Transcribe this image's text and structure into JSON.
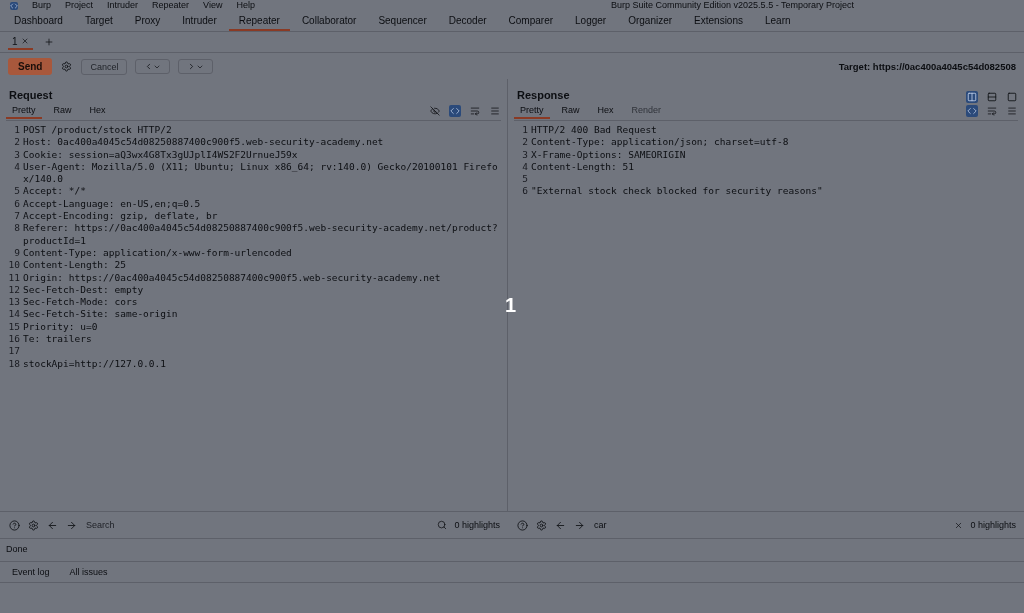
{
  "window": {
    "title": "Burp Suite Community Edition v2025.5.5 - Temporary Project",
    "menu": [
      "Burp",
      "Project",
      "Intruder",
      "Repeater",
      "View",
      "Help"
    ]
  },
  "main_tabs": [
    {
      "label": "Dashboard",
      "selected": false
    },
    {
      "label": "Target",
      "selected": false
    },
    {
      "label": "Proxy",
      "selected": false
    },
    {
      "label": "Intruder",
      "selected": false
    },
    {
      "label": "Repeater",
      "selected": true
    },
    {
      "label": "Collaborator",
      "selected": false
    },
    {
      "label": "Sequencer",
      "selected": false
    },
    {
      "label": "Decoder",
      "selected": false
    },
    {
      "label": "Comparer",
      "selected": false
    },
    {
      "label": "Logger",
      "selected": false
    },
    {
      "label": "Organizer",
      "selected": false
    },
    {
      "label": "Extensions",
      "selected": false
    },
    {
      "label": "Learn",
      "selected": false
    }
  ],
  "repeater_tabs": [
    {
      "label": "1",
      "selected": true
    }
  ],
  "toolbar": {
    "send": "Send",
    "cancel": "Cancel",
    "target": "Target: https://0ac400a4045c54d082508"
  },
  "view_modes": [
    {
      "selected": true
    },
    {
      "selected": false
    },
    {
      "selected": false
    }
  ],
  "request": {
    "title": "Request",
    "tabs": [
      {
        "label": "Pretty",
        "selected": true
      },
      {
        "label": "Raw",
        "selected": false
      },
      {
        "label": "Hex",
        "selected": false
      }
    ],
    "lines": [
      {
        "num": "1",
        "text": "POST /product/stock HTTP/2"
      },
      {
        "num": "2",
        "text": "Host: 0ac400a4045c54d08250887400c900f5.web-security-academy.net"
      },
      {
        "num": "3",
        "text": "Cookie: session=aQ3wx4G8Tx3gUJplI4WS2F2UrnueJ59x"
      },
      {
        "num": "4",
        "text": "User-Agent: Mozilla/5.0 (X11; Ubuntu; Linux x86_64; rv:140.0) Gecko/20100101 Firefox/140.0"
      },
      {
        "num": "5",
        "text": "Accept: */*"
      },
      {
        "num": "6",
        "text": "Accept-Language: en-US,en;q=0.5"
      },
      {
        "num": "7",
        "text": "Accept-Encoding: gzip, deflate, br"
      },
      {
        "num": "8",
        "text": "Referer: https://0ac400a4045c54d08250887400c900f5.web-security-academy.net/product?productId=1"
      },
      {
        "num": "9",
        "text": "Content-Type: application/x-www-form-urlencoded"
      },
      {
        "num": "10",
        "text": "Content-Length: 25"
      },
      {
        "num": "11",
        "text": "Origin: https://0ac400a4045c54d08250887400c900f5.web-security-academy.net"
      },
      {
        "num": "12",
        "text": "Sec-Fetch-Dest: empty"
      },
      {
        "num": "13",
        "text": "Sec-Fetch-Mode: cors"
      },
      {
        "num": "14",
        "text": "Sec-Fetch-Site: same-origin"
      },
      {
        "num": "15",
        "text": "Priority: u=0"
      },
      {
        "num": "16",
        "text": "Te: trailers"
      },
      {
        "num": "17"
      },
      {
        "num": "18",
        "text": "stockApi=http://127.0.0.1"
      }
    ]
  },
  "response": {
    "title": "Response",
    "tabs": [
      {
        "label": "Pretty",
        "selected": true,
        "disabled": false
      },
      {
        "label": "Raw",
        "selected": false,
        "disabled": false
      },
      {
        "label": "Hex",
        "selected": false,
        "disabled": false
      },
      {
        "label": "Render",
        "selected": false,
        "disabled": true
      }
    ],
    "lines": [
      {
        "num": "1",
        "text": "HTTP/2 400 Bad Request"
      },
      {
        "num": "2",
        "text": "Content-Type: application/json; charset=utf-8"
      },
      {
        "num": "3",
        "text": "X-Frame-Options: SAMEORIGIN"
      },
      {
        "num": "4",
        "text": "Content-Length: 51"
      },
      {
        "num": "5"
      },
      {
        "num": "6",
        "text": "\"External stock check blocked for security reasons\""
      }
    ]
  },
  "search_bars": [
    {
      "placeholder": "Search",
      "highlights": "0 highlights"
    },
    {
      "value": "car",
      "highlights": "0 highlights"
    }
  ],
  "status": "Done",
  "bottom_tabs": [
    {
      "label": "Event log"
    },
    {
      "label": "All issues"
    }
  ],
  "step_marker": "1"
}
